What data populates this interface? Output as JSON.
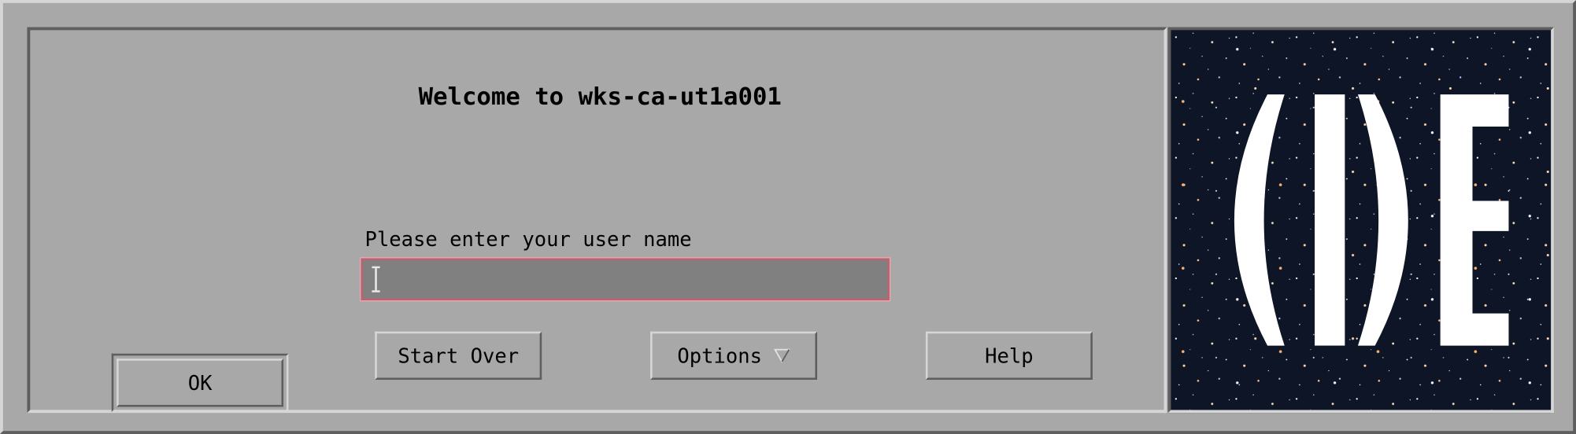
{
  "welcome_title": "Welcome to wks-ca-ut1a001",
  "login": {
    "prompt": "Please enter your user name",
    "username_value": ""
  },
  "buttons": {
    "ok": "OK",
    "start_over": "Start Over",
    "options": "Options",
    "help": "Help"
  },
  "logo": {
    "text": "CDE",
    "background": "#0d1526"
  },
  "icons": {
    "options_menu": "down-triangle-icon",
    "text_cursor": "i-beam-cursor-icon"
  },
  "colors": {
    "panel": "#a8a8a8",
    "input_bg": "#808080",
    "input_focus_border": "#c06070"
  }
}
